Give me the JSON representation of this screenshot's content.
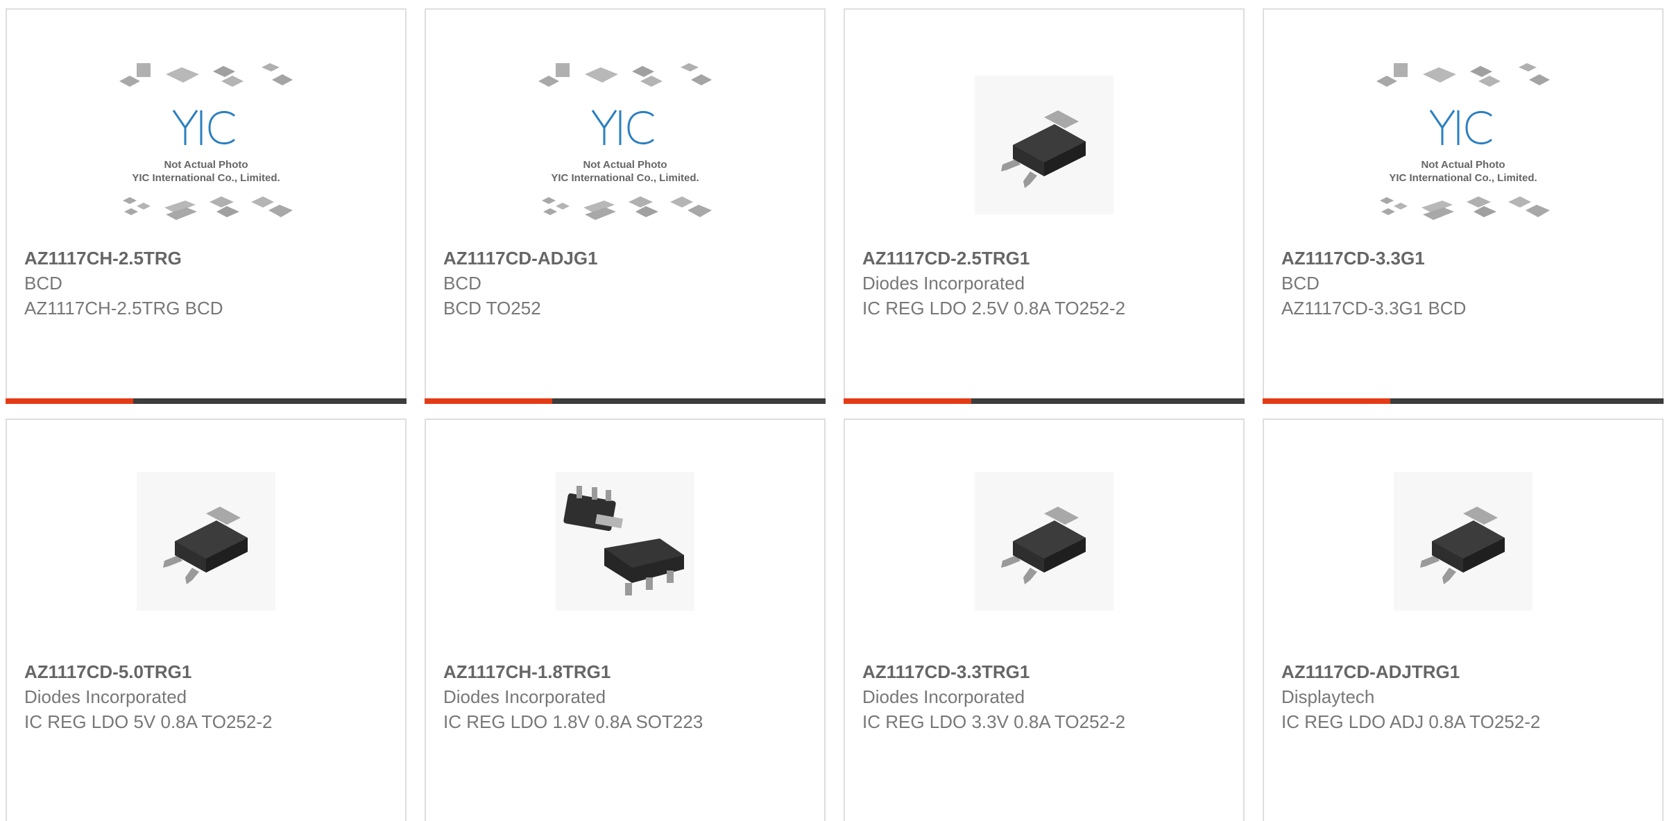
{
  "placeholder_image": {
    "brand": "YIC",
    "caption_line1": "Not Actual Photo",
    "caption_line2": "YIC International Co., Limited."
  },
  "colors": {
    "accent": "#e43b15",
    "bar_dark": "#3d3d3d",
    "card_border": "#dedede"
  },
  "products": [
    {
      "part_number": "AZ1117CH-2.5TRG",
      "manufacturer": "BCD",
      "description": "AZ1117CH-2.5TRG BCD",
      "image": "yic-placeholder"
    },
    {
      "part_number": "AZ1117CD-ADJG1",
      "manufacturer": "BCD",
      "description": "BCD TO252",
      "image": "yic-placeholder"
    },
    {
      "part_number": "AZ1117CD-2.5TRG1",
      "manufacturer": "Diodes Incorporated",
      "description": "IC REG LDO 2.5V 0.8A TO252-2",
      "image": "to252-package"
    },
    {
      "part_number": "AZ1117CD-3.3G1",
      "manufacturer": "BCD",
      "description": "AZ1117CD-3.3G1 BCD",
      "image": "yic-placeholder"
    },
    {
      "part_number": "AZ1117CD-5.0TRG1",
      "manufacturer": "Diodes Incorporated",
      "description": "IC REG LDO 5V 0.8A TO252-2",
      "image": "to252-package"
    },
    {
      "part_number": "AZ1117CH-1.8TRG1",
      "manufacturer": "Diodes Incorporated",
      "description": "IC REG LDO 1.8V 0.8A SOT223",
      "image": "sot223-package"
    },
    {
      "part_number": "AZ1117CD-3.3TRG1",
      "manufacturer": "Diodes Incorporated",
      "description": "IC REG LDO 3.3V 0.8A TO252-2",
      "image": "to252-package"
    },
    {
      "part_number": "AZ1117CD-ADJTRG1",
      "manufacturer": "Displaytech",
      "description": "IC REG LDO ADJ 0.8A TO252-2",
      "image": "to252-package"
    }
  ]
}
